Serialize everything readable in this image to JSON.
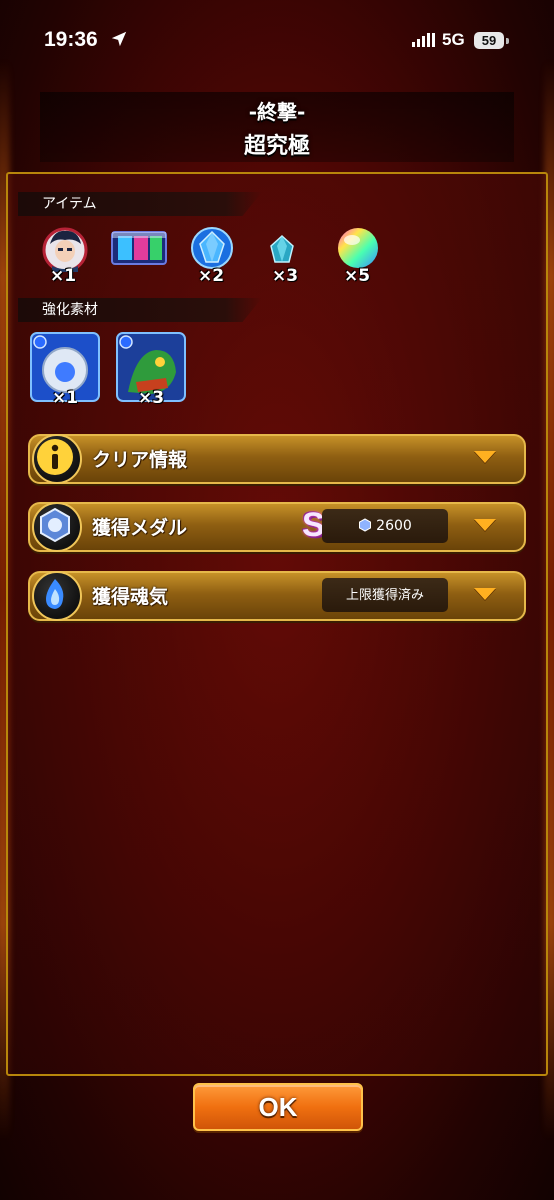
{
  "status_bar": {
    "time": "19:36",
    "network": "5G",
    "battery": "59"
  },
  "header": {
    "title": "-終撃-",
    "subtitle": "超究極"
  },
  "items_section": {
    "label": "アイテム",
    "items": [
      {
        "icon": "character-portrait",
        "qty": "×1"
      },
      {
        "icon": "card-item",
        "qty": ""
      },
      {
        "icon": "blue-crystal",
        "qty": "×2"
      },
      {
        "icon": "small-blue-crystal",
        "qty": "×3"
      },
      {
        "icon": "rainbow-orb",
        "qty": "×5"
      }
    ]
  },
  "materials_section": {
    "label": "強化素材",
    "items": [
      {
        "icon": "blue-material-monster",
        "qty": "×1"
      },
      {
        "icon": "green-material-monster",
        "qty": "×3"
      }
    ]
  },
  "bars": {
    "clear_info": {
      "label": "クリア情報",
      "icon": "info-icon"
    },
    "medal": {
      "label": "獲得メダル",
      "rank": "S",
      "value": "2600",
      "icon": "medal-icon"
    },
    "soul": {
      "label": "獲得魂気",
      "value": "上限獲得済み",
      "icon": "soul-flame-icon"
    }
  },
  "ok_button": "OK",
  "colors": {
    "gold": "#c69128",
    "ok_orange": "#f07010",
    "arrow": "#ffb020"
  }
}
